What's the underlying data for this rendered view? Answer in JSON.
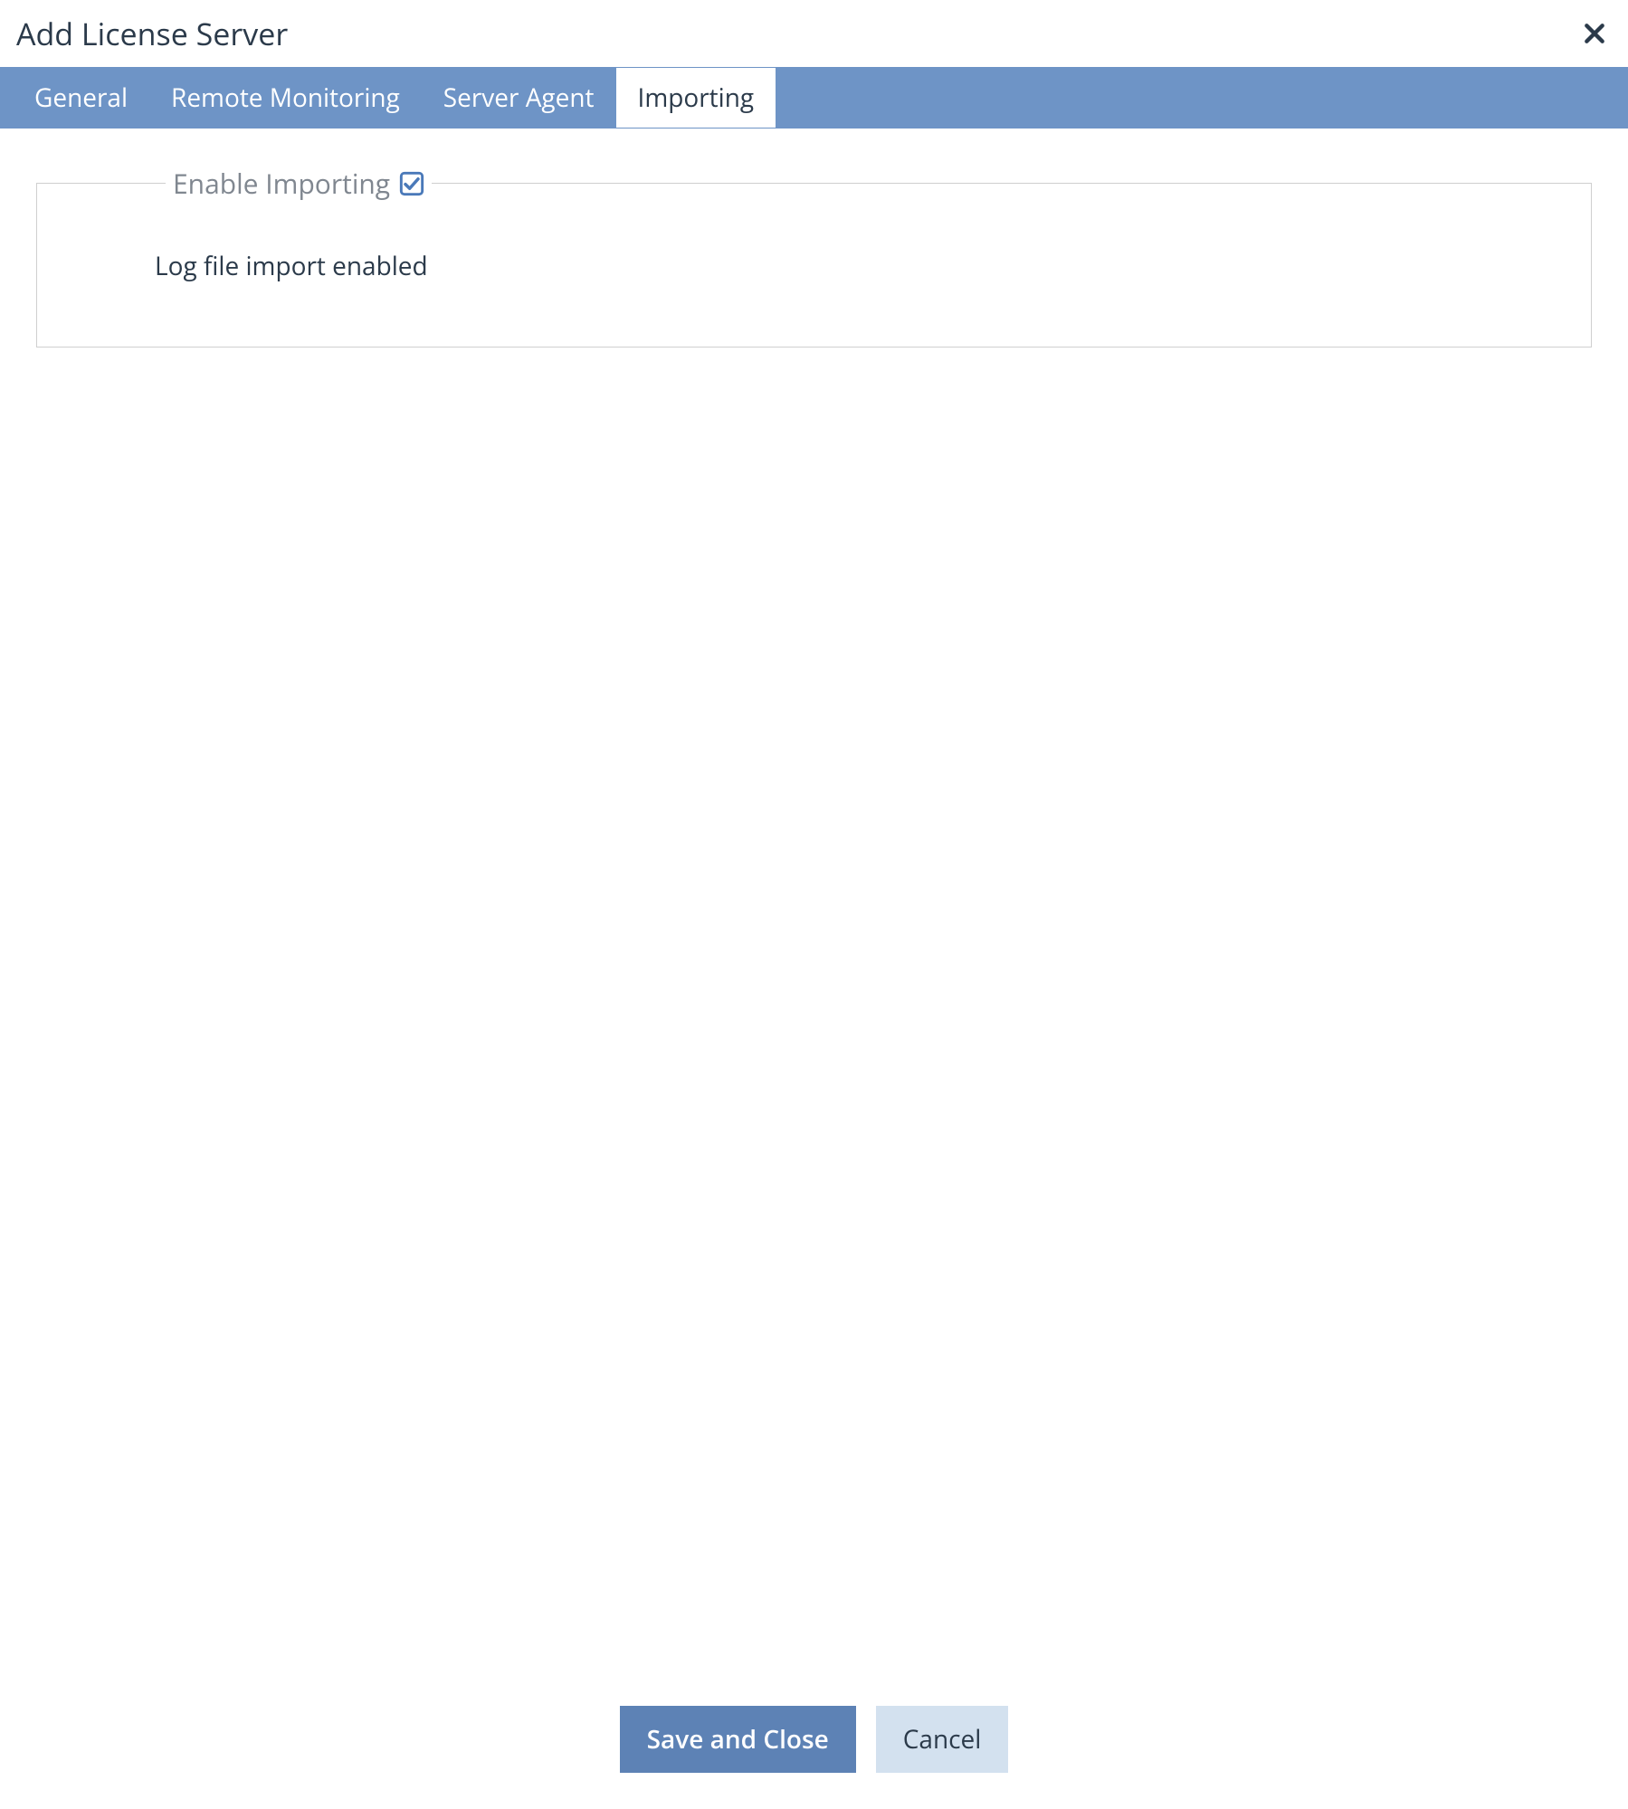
{
  "dialog": {
    "title": "Add License Server"
  },
  "tabs": {
    "general": "General",
    "remote_monitoring": "Remote Monitoring",
    "server_agent": "Server Agent",
    "importing": "Importing",
    "active": "importing"
  },
  "importing_panel": {
    "fieldset_legend": "Enable Importing",
    "checkbox_checked": true,
    "body_text": "Log file import enabled"
  },
  "buttons": {
    "save_and_close": "Save and Close",
    "cancel": "Cancel"
  },
  "colors": {
    "tab_bar_bg": "#6e94c6",
    "primary_btn_bg": "#5d82b5",
    "secondary_btn_bg": "#d3e1ef",
    "check_color": "#4a79b9"
  }
}
